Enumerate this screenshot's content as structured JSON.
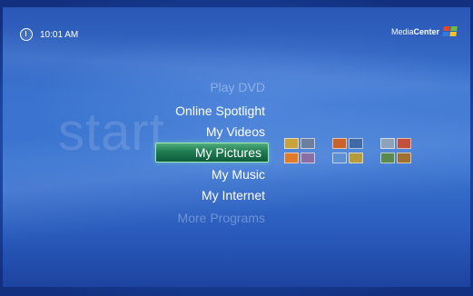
{
  "header": {
    "time": "10:01 AM"
  },
  "brand": {
    "prefix": "Media",
    "bold": "Center"
  },
  "background_word": "start",
  "menu": [
    {
      "label": "Play DVD",
      "state": "faded"
    },
    {
      "label": "Online Spotlight",
      "state": "normal"
    },
    {
      "label": "My Videos",
      "state": "normal"
    },
    {
      "label": "My Pictures",
      "state": "selected"
    },
    {
      "label": "My Music",
      "state": "normal"
    },
    {
      "label": "My Internet",
      "state": "normal"
    },
    {
      "label": "More Programs",
      "state": "faded"
    }
  ],
  "colors": {
    "background": "#2f62bd",
    "selection": "#1f7c52",
    "selection_border": "#9fe6b9",
    "text": "#ffffff"
  },
  "icons": [
    "power-icon",
    "windows-flag-icon"
  ],
  "picture_thumbnails": [
    {
      "group": 1,
      "colors": [
        "#c8a23a",
        "#6d7f9c",
        "#e07b2a",
        "#8a6fa5"
      ]
    },
    {
      "group": 2,
      "colors": [
        "#c9622b",
        "#3e6aa6",
        "#5e8fd0",
        "#b59a3e"
      ]
    },
    {
      "group": 3,
      "colors": [
        "#8fa3b8",
        "#c0503a",
        "#5a8a4e",
        "#a0702e"
      ]
    }
  ]
}
